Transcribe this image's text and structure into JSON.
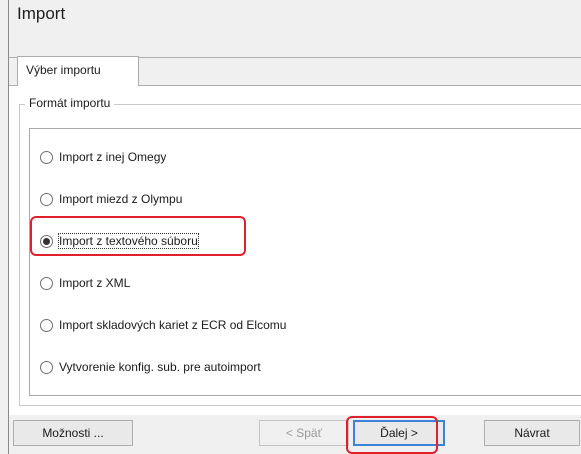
{
  "window": {
    "title": "Import"
  },
  "tabs": [
    {
      "label": "Výber importu"
    }
  ],
  "group": {
    "legend": "Formát importu"
  },
  "options": [
    {
      "label": "Import z inej Omegy",
      "selected": false
    },
    {
      "label": "Import miezd z Olympu",
      "selected": false
    },
    {
      "label": "Import z textového súboru",
      "selected": true
    },
    {
      "label": "Import z XML",
      "selected": false
    },
    {
      "label": "Import skladových kariet z ECR od Elcomu",
      "selected": false
    },
    {
      "label": "Vytvorenie konfig. sub. pre autoimport",
      "selected": false
    }
  ],
  "buttons": {
    "options": "Možnosti ...",
    "back": "< Späť",
    "next": "Ďalej >",
    "return": "Návrat"
  },
  "colors": {
    "highlight": "#e0202a",
    "focus_border": "#3b83d6"
  }
}
